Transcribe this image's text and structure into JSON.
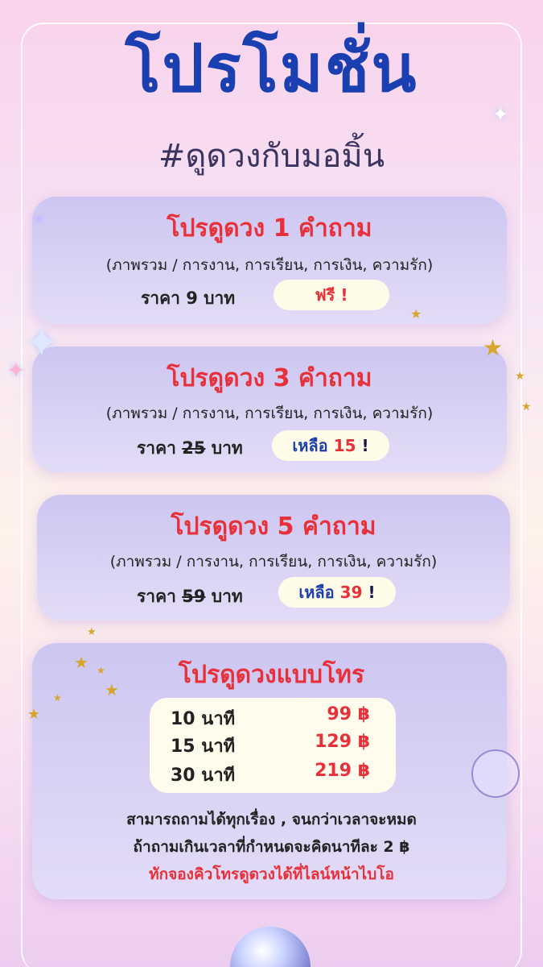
{
  "header": {
    "title": "โปรโมชั่น",
    "subtitle": "#ดูดวงกับมอมิ้น"
  },
  "cards": [
    {
      "title": "โปรดูดวง 1 คำถาม",
      "desc": "(ภาพรวม / การงาน, การเรียน, การเงิน, ความรัก)",
      "price_prefix": "ราคา",
      "price_value": "9",
      "price_unit": "บาท",
      "promo_word": "",
      "promo_value": "ฟรี !"
    },
    {
      "title": "โปรดูดวง 3 คำถาม",
      "desc": "(ภาพรวม / การงาน, การเรียน, การเงิน, ความรัก)",
      "price_prefix": "ราคา",
      "price_value": "25",
      "price_unit": "บาท",
      "promo_word": "เหลือ",
      "promo_value": "15",
      "promo_suffix": "!"
    },
    {
      "title": "โปรดูดวง 5 คำถาม",
      "desc": "(ภาพรวม / การงาน, การเรียน, การเงิน, ความรัก)",
      "price_prefix": "ราคา",
      "price_value": "59",
      "price_unit": "บาท",
      "promo_word": "เหลือ",
      "promo_value": "39",
      "promo_suffix": "!"
    }
  ],
  "call": {
    "title": "โปรดูดวงแบบโทร",
    "rows": [
      {
        "duration": "10 นาที",
        "price": "99  ฿"
      },
      {
        "duration": "15 นาที",
        "price": "129 ฿"
      },
      {
        "duration": "30 นาที",
        "price": "219 ฿"
      }
    ],
    "note1": "สามารถถามได้ทุกเรื่อง , จนกว่าเวลาจะหมด",
    "note2": "ถ้าถามเกินเวลาที่กำหนดจะคิดนาทีละ 2 ฿",
    "note3": "ทักจองคิวโทรดูดวงได้ที่ไลน์หน้าไบโอ"
  },
  "colors": {
    "title_blue": "#1a3fb0",
    "accent_red": "#e8303a",
    "card_lavender": "#d6cff4",
    "pill_cream": "#fffbe9"
  },
  "icons": {
    "stars": "star-icon",
    "sparkle": "sparkle-icon",
    "crystal_ball": "crystal-ball-icon"
  }
}
